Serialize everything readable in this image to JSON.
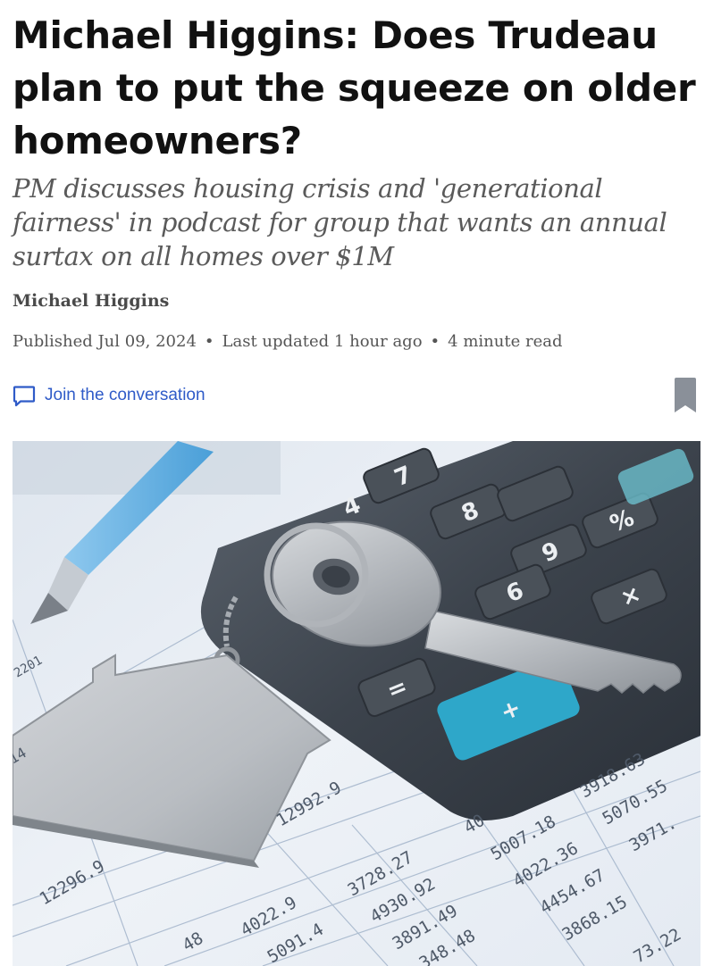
{
  "article": {
    "headline": "Michael Higgins: Does Trudeau plan to put the squeeze on older homeowners?",
    "deck": "PM discusses housing crisis and 'generational fairness' in podcast for group that wants an annual surtax on all homes over $1M",
    "author": "Michael Higgins",
    "published": "Published Jul 09, 2024",
    "updated": "Last updated 1 hour ago",
    "read_time": "4 minute read",
    "separator": "•"
  },
  "actions": {
    "join_label": "Join the conversation",
    "join_icon": "comment-icon",
    "bookmark_icon": "bookmark-icon"
  },
  "hero_image": {
    "numbers": {
      "n1": "12296.9",
      "n2": "12992.9",
      "n3": "4022.9",
      "n4": "5091.4",
      "n5": "3728.27",
      "n6": "4930.92",
      "n7": "3891.49",
      "n8": "348.48",
      "n9": "5007.18",
      "n10": "4022.36",
      "n11": "4454.67",
      "n12": "3868.15",
      "n13": "3918.63",
      "n14": "5070.55",
      "n15": "3971.",
      "n16": "73.22",
      "n17": "40",
      "n18": "48",
      "n19": "2201",
      "n20": "14"
    },
    "calculator_keys": {
      "k_times": "×",
      "k_plus": "+",
      "k_equals": "=",
      "k_6": "6",
      "k_9": "9",
      "k_8": "8",
      "k_7": "7",
      "k_4": "4",
      "k_pct": "%"
    }
  },
  "colors": {
    "link": "#2f5bc8",
    "bookmark": "#8a9099",
    "calc_key_plus": "#2ea7c9",
    "pen": "#5aaede"
  }
}
